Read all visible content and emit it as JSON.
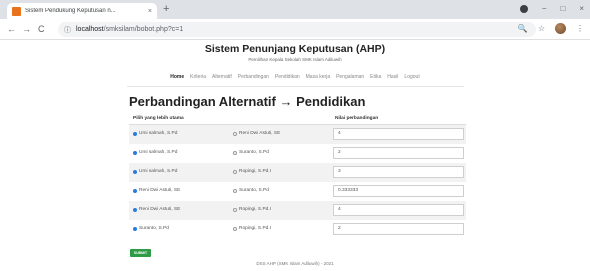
{
  "browser": {
    "tab_title": "Sistem Pendukung Keputusan n...",
    "tab_close": "×",
    "new_tab": "+",
    "url_host": "localhost",
    "url_path": "/smksilam/bobot.php?c=1",
    "back": "←",
    "forward": "→",
    "reload": "C",
    "info_icon": "ⓘ",
    "zoom_icon": "🔍",
    "star_icon": "☆",
    "menu_icon": "⋮",
    "minimize": "−",
    "maximize": "□",
    "close": "×"
  },
  "site": {
    "title": "Sistem Penunjang Keputusan (AHP)",
    "subtitle": "Pemilihan Kepala Sekolah SMK Islam Adiluwih"
  },
  "nav": {
    "items": [
      "Home",
      "Kriteria",
      "Alternatif",
      "Perbandingan",
      "Pendidikan",
      "Masa kerja",
      "Pengalaman",
      "Etika",
      "Hasil",
      "Logout"
    ]
  },
  "page": {
    "heading": "Perbandingan Alternatif → Pendidikan"
  },
  "table": {
    "col_headers": [
      "Pilih yang lebih utama",
      "",
      "Nilai perbandingan"
    ],
    "rows": [
      {
        "left": "Umi salmah, S.Pd",
        "right": "Reni Dwi Astuti, SE",
        "value": "4"
      },
      {
        "left": "Umi salmah, S.Pd",
        "right": "Suranto, S.Pd",
        "value": "2"
      },
      {
        "left": "Umi salmah, S.Pd",
        "right": "Ropingi, S.Pd.I",
        "value": "3"
      },
      {
        "left": "Reni Dwi Astuti, SE",
        "right": "Suranto, S.Pd",
        "value": "0.333333"
      },
      {
        "left": "Reni Dwi Astuti, SE",
        "right": "Ropingi, S.Pd.I",
        "value": "4"
      },
      {
        "left": "Suranto, S.Pd",
        "right": "Ropingi, S.Pd.I",
        "value": "2"
      }
    ]
  },
  "form": {
    "submit_label": "SUBMIT"
  },
  "footer": {
    "text": "DSS AHP (SMK Islam Adiluwih) - 2021"
  }
}
